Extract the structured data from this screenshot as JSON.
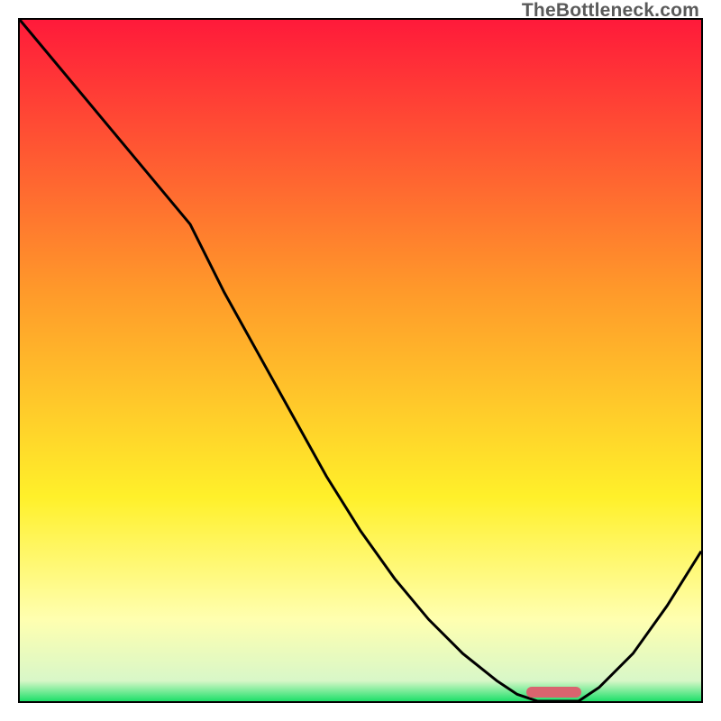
{
  "watermark": "TheBottleneck.com",
  "colors": {
    "red_top": "#ff1a3a",
    "orange": "#ff9a2a",
    "yellow": "#fff02a",
    "pale_yellow": "#ffffb0",
    "green": "#1ee06a",
    "curve": "#000000",
    "marker": "#d9646f",
    "border": "#000000"
  },
  "chart_data": {
    "type": "line",
    "title": "",
    "xlabel": "",
    "ylabel": "",
    "x": [
      0,
      5,
      10,
      15,
      20,
      25,
      30,
      35,
      40,
      45,
      50,
      55,
      60,
      65,
      70,
      73,
      76,
      79,
      82,
      85,
      90,
      95,
      100
    ],
    "values": [
      100,
      94,
      88,
      82,
      76,
      70,
      60,
      51,
      42,
      33,
      25,
      18,
      12,
      7,
      3,
      1,
      0,
      0,
      0,
      2,
      7,
      14,
      22
    ],
    "xlim": [
      0,
      100
    ],
    "ylim": [
      0,
      100
    ],
    "marker": {
      "x_start": 74,
      "x_end": 82,
      "y": 0
    },
    "gradient_stops": [
      {
        "offset": 0.0,
        "color": "#ff1a3a"
      },
      {
        "offset": 0.4,
        "color": "#ff9a2a"
      },
      {
        "offset": 0.7,
        "color": "#fff02a"
      },
      {
        "offset": 0.88,
        "color": "#ffffb0"
      },
      {
        "offset": 0.97,
        "color": "#d8f7c8"
      },
      {
        "offset": 1.0,
        "color": "#1ee06a"
      }
    ]
  }
}
